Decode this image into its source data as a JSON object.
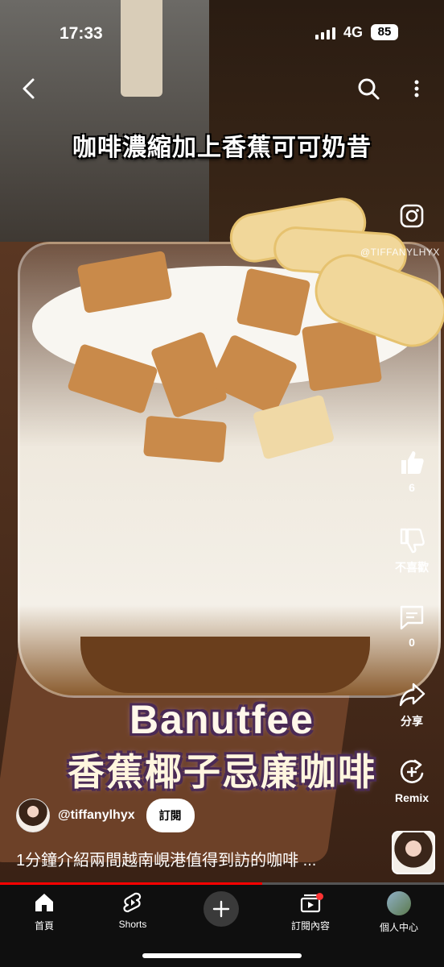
{
  "status_bar": {
    "time": "17:33",
    "network": "4G",
    "battery": "85"
  },
  "video": {
    "headline": "咖啡濃縮加上香蕉可可奶昔",
    "watermark": "@TIFFANYLHYX",
    "caption_line1": "Banutfee",
    "caption_line2": "香蕉椰子忌廉咖啡"
  },
  "actions": {
    "like_count": "6",
    "dislike_label": "不喜歡",
    "comment_count": "0",
    "share_label": "分享",
    "remix_label": "Remix"
  },
  "channel": {
    "handle": "@tiffanylhyx",
    "subscribe_label": "訂閱",
    "video_title": "1分鐘介紹兩間越南峴港值得到訪的咖啡 ..."
  },
  "progress_fraction": 0.59,
  "nav": [
    {
      "label": "首頁",
      "icon": "home-icon"
    },
    {
      "label": "Shorts",
      "icon": "shorts-icon"
    },
    {
      "label": "",
      "icon": "plus-icon"
    },
    {
      "label": "訂閱內容",
      "icon": "subscriptions-icon"
    },
    {
      "label": "個人中心",
      "icon": "profile-avatar-icon"
    }
  ],
  "colors": {
    "progress": "#ff0000",
    "navbar_bg": "#0f0f0f"
  }
}
